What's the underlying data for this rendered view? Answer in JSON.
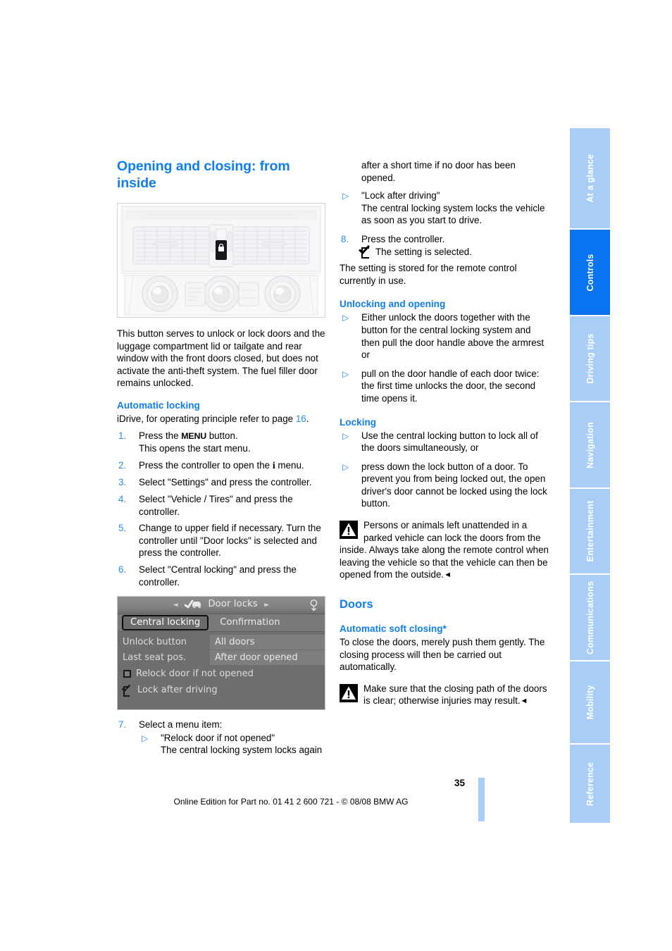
{
  "page_number": "35",
  "footer_line": "Online Edition for Part no. 01 41 2 600 721 - © 08/08 BMW AG",
  "colors": {
    "heading_blue": "#0f7ef5",
    "tab_inactive": "#a8cdf7",
    "tab_active": "#0a74f0",
    "link_blue": "#2a8bf2"
  },
  "tabs": [
    {
      "label": "At a glance",
      "active": false
    },
    {
      "label": "Controls",
      "active": true
    },
    {
      "label": "Driving tips",
      "active": false
    },
    {
      "label": "Navigation",
      "active": false
    },
    {
      "label": "Entertainment",
      "active": false
    },
    {
      "label": "Communications",
      "active": false
    },
    {
      "label": "Mobility",
      "active": false
    },
    {
      "label": "Reference",
      "active": false
    }
  ],
  "left": {
    "title": "Opening and closing: from inside",
    "figure_name": "center-console-central-locking-button",
    "intro": "This button serves to unlock or lock doors and the luggage compartment lid or tailgate and rear window with the front doors closed, but does not activate the anti-theft system. The fuel filler door remains unlocked.",
    "automatic_locking": {
      "heading": "Automatic locking",
      "lead_before": "iDrive, for operating principle refer to page ",
      "lead_page_ref": "16",
      "lead_after": ".",
      "steps": [
        {
          "num": "1.",
          "text_parts": [
            "Press the ",
            "MENU",
            " button."
          ],
          "sub": "This opens the start menu."
        },
        {
          "num": "2.",
          "text_parts": [
            "Press the controller to open the ",
            "i",
            " menu."
          ],
          "sub": ""
        },
        {
          "num": "3.",
          "text": "Select \"Settings\" and press the controller.",
          "sub": ""
        },
        {
          "num": "4.",
          "text": "Select \"Vehicle / Tires\" and press the controller.",
          "sub": ""
        },
        {
          "num": "5.",
          "text": "Change to upper field if necessary. Turn the controller until \"Door locks\" is selected and press the controller.",
          "sub": ""
        },
        {
          "num": "6.",
          "text": "Select \"Central locking\" and press the controller.",
          "sub": ""
        }
      ],
      "step7": {
        "num": "7.",
        "text": "Select a menu item:",
        "bullet_title": "\"Relock door if not opened\"",
        "bullet_body": "The central locking system locks again"
      }
    },
    "idrive_screen": {
      "header_title": "Door locks",
      "left_arrow": "◄",
      "right_arrow": "►",
      "tabs": [
        {
          "label": "Central locking",
          "selected": true
        },
        {
          "label": "Confirmation",
          "selected": false
        }
      ],
      "rows": [
        {
          "key": "Unlock button",
          "value": "All doors"
        },
        {
          "key": "Last seat pos.",
          "value": "After door opened"
        }
      ],
      "checkboxes": [
        {
          "label": "Relock door if not opened",
          "checked": false
        },
        {
          "label": "Lock after driving",
          "checked": true
        }
      ]
    }
  },
  "right": {
    "continuation": "after a short time if no door has been opened.",
    "bullet_lock_after_driving": {
      "title": "\"Lock after driving\"",
      "body": "The central locking system locks the vehicle as soon as you start to drive."
    },
    "step8": {
      "num": "8.",
      "text": "Press the controller.",
      "sub": "The setting is selected."
    },
    "stored_note": "The setting is stored for the remote control currently in use.",
    "unlocking": {
      "heading": "Unlocking and opening",
      "bullets": [
        "Either unlock the doors together with the button for the central locking system and then pull the door handle above the armrest or",
        "pull on the door handle of each door twice: the first time unlocks the door, the second time opens it."
      ]
    },
    "locking": {
      "heading": "Locking",
      "bullets": [
        "Use the central locking button to lock all of the doors simultaneously, or",
        "press down the lock button of a door. To prevent you from being locked out, the open driver's door cannot be locked using the lock button."
      ],
      "warning": "Persons or animals left unattended in a parked vehicle can lock the doors from the inside. Always take along the remote control when leaving the vehicle so that the vehicle can then be opened from the outside.",
      "warning_end_mark": "◄"
    },
    "doors": {
      "heading": "Doors",
      "subheading": "Automatic soft closing*",
      "body": "To close the doors, merely push them gently. The closing process will then be carried out automatically.",
      "warning": "Make sure that the closing path of the doors is clear; otherwise injuries may result.",
      "warning_end_mark": "◄"
    }
  }
}
